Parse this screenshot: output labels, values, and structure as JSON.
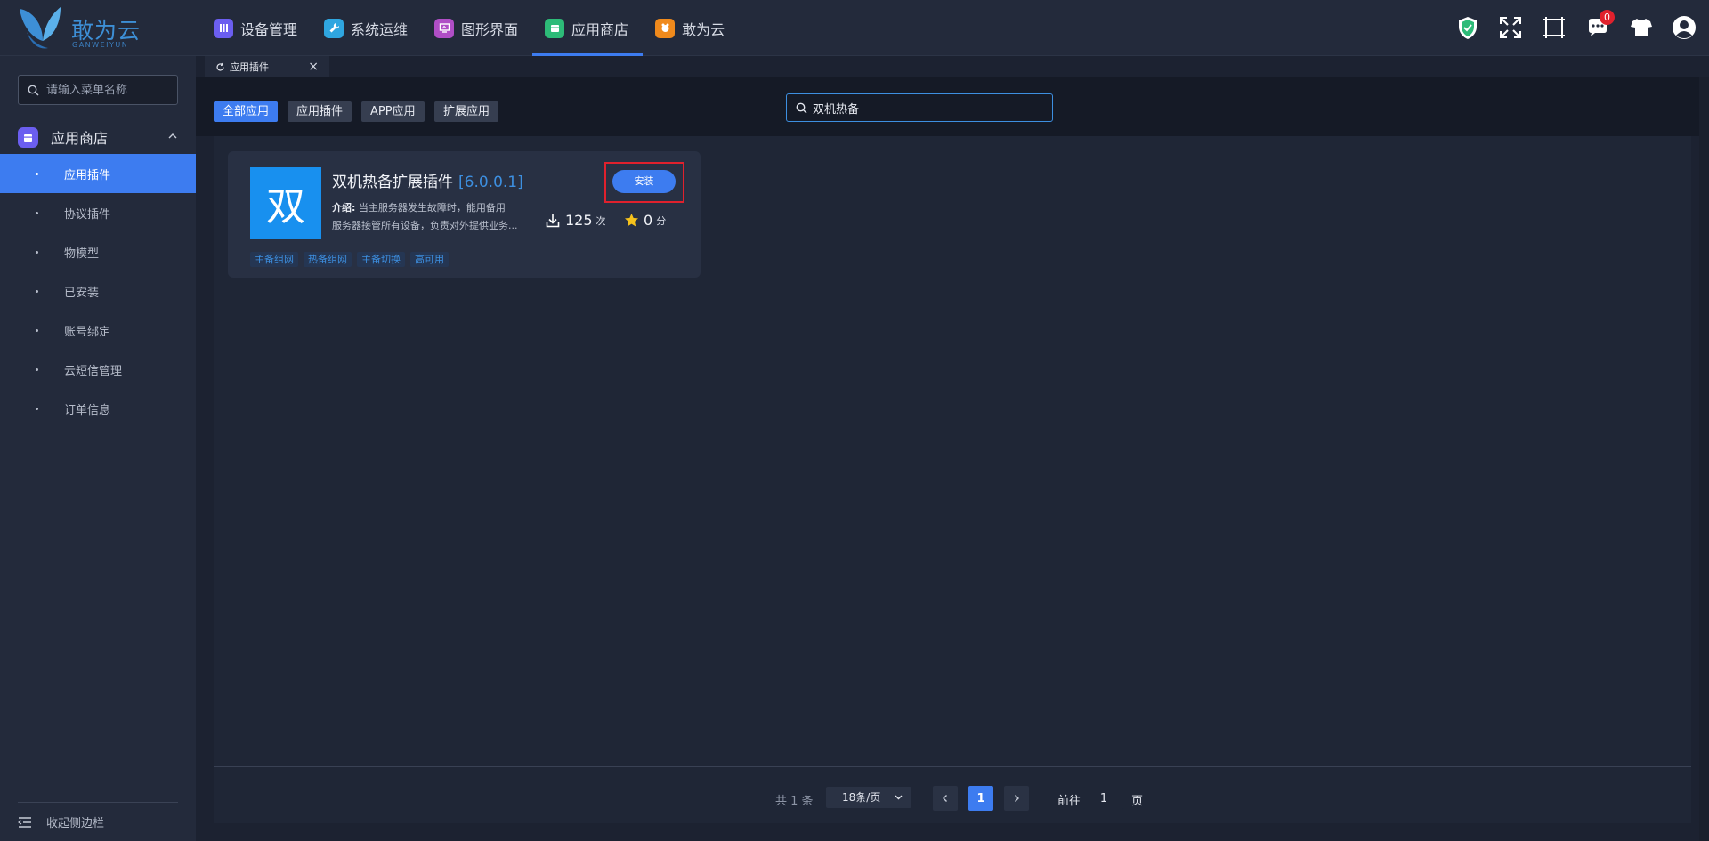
{
  "header": {
    "logo_text": "敢为云",
    "logo_sub": "GANWEIYUN",
    "nav": [
      {
        "label": "设备管理",
        "color": "#6b5ef0",
        "icon": "device-icon"
      },
      {
        "label": "系统运维",
        "color": "#2fa6e0",
        "icon": "wrench-icon"
      },
      {
        "label": "图形界面",
        "color": "#b04ec6",
        "icon": "graphic-icon"
      },
      {
        "label": "应用商店",
        "color": "#2dbb78",
        "icon": "store-icon"
      },
      {
        "label": "敢为云",
        "color": "#f08a1c",
        "icon": "cloud-brand-icon"
      }
    ],
    "active_nav": 3,
    "notification_count": "0"
  },
  "sidebar": {
    "search_placeholder": "请输入菜单名称",
    "group_label": "应用商店",
    "items": [
      {
        "label": "应用插件"
      },
      {
        "label": "协议插件"
      },
      {
        "label": "物模型"
      },
      {
        "label": "已安装"
      },
      {
        "label": "账号绑定"
      },
      {
        "label": "云短信管理"
      },
      {
        "label": "订单信息"
      }
    ],
    "collapse_label": "收起侧边栏"
  },
  "tabs": {
    "current": "应用插件"
  },
  "filters": {
    "buttons": [
      "全部应用",
      "应用插件",
      "APP应用",
      "扩展应用"
    ],
    "search_value": "双机热备"
  },
  "card": {
    "icon_char": "双",
    "title": "双机热备扩展插件",
    "version": "[6.0.0.1]",
    "desc_label": "介绍:",
    "desc_line1": "当主服务器发生故障时，能用备用",
    "desc_line2": "服务器接管所有设备，负责对外提供业务...",
    "downloads": "125",
    "downloads_unit": "次",
    "rating": "0",
    "rating_unit": "分",
    "install_label": "安装",
    "tags": [
      "主备组网",
      "热备组网",
      "主备切换",
      "高可用"
    ]
  },
  "pagination": {
    "total": "共 1 条",
    "page_size": "18条/页",
    "current_page": "1",
    "goto_label": "前往",
    "goto_value": "1",
    "page_suffix": "页"
  }
}
